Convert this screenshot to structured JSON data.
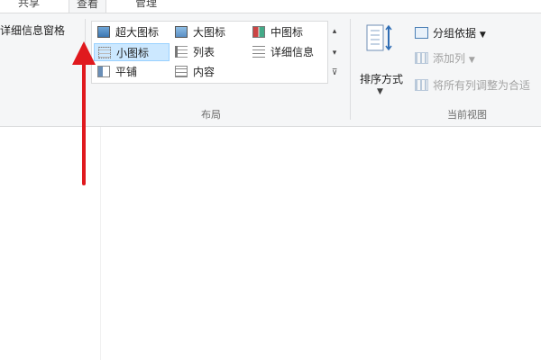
{
  "tabs": {
    "share": "共享",
    "view": "查看",
    "manage": "管理"
  },
  "panes": {
    "details_pane": "详细信息窗格"
  },
  "layout": {
    "group_label": "布局",
    "items": {
      "extra_large": "超大图标",
      "large": "大图标",
      "medium": "中图标",
      "small": "小图标",
      "list": "列表",
      "details": "详细信息",
      "tiles": "平铺",
      "content": "内容"
    },
    "selected": "小图标"
  },
  "current_view": {
    "group_label": "当前视图",
    "sort_by": "排序方式",
    "group_by": "分组依据",
    "add_columns": "添加列",
    "size_all_columns": "将所有列调整为合适"
  },
  "annotation": {
    "color": "#e0191e"
  },
  "colors": {
    "ribbon_bg": "#f5f6f7",
    "selection_bg": "#cce8ff",
    "disabled_text": "#a3a3a3"
  }
}
